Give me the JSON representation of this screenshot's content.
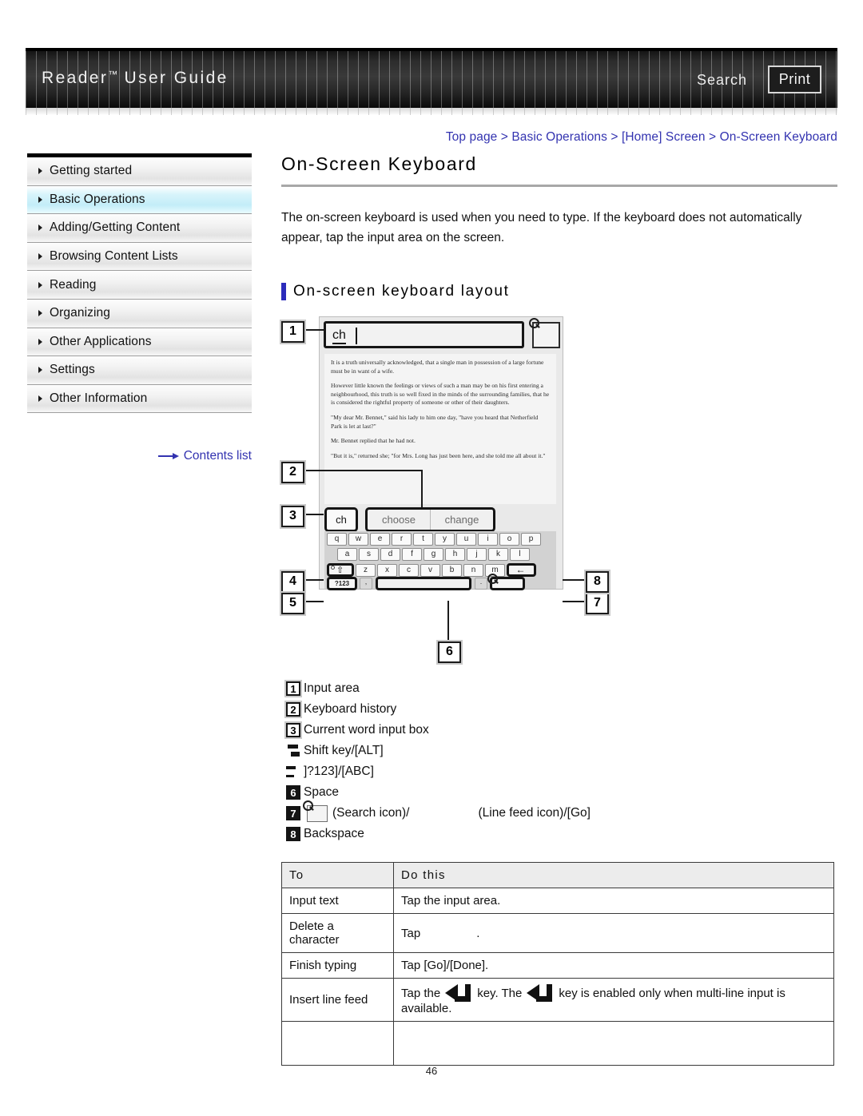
{
  "header": {
    "title_main": "Reader",
    "title_tm": "™",
    "title_rest": " User Guide",
    "search_label": "Search",
    "print_label": "Print"
  },
  "breadcrumb": {
    "text": "Top page > Basic Operations > [Home] Screen > On-Screen Keyboard"
  },
  "sidebar": {
    "items": [
      {
        "label": "Getting started",
        "active": false
      },
      {
        "label": "Basic Operations",
        "active": true
      },
      {
        "label": "Adding/Getting Content",
        "active": false
      },
      {
        "label": "Browsing Content Lists",
        "active": false
      },
      {
        "label": "Reading",
        "active": false
      },
      {
        "label": "Organizing",
        "active": false
      },
      {
        "label": "Other Applications",
        "active": false
      },
      {
        "label": "Settings",
        "active": false
      },
      {
        "label": "Other Information",
        "active": false
      }
    ],
    "contents_list_label": "Contents list"
  },
  "main": {
    "page_title": "On-Screen Keyboard",
    "intro": "The on-screen keyboard is used when you need to type. If the keyboard does not automatically appear, tap the input area on the screen.",
    "section_heading": "On-screen keyboard layout"
  },
  "figure": {
    "callouts": [
      "1",
      "2",
      "3",
      "4",
      "5",
      "6",
      "7",
      "8"
    ],
    "input_value": "ch",
    "reader_paragraphs": [
      "It is a truth universally acknowledged, that a single man in possession of a large fortune must be in want of a wife.",
      "However little known the feelings or views of such a man may be on his first entering a neighbourhood, this truth is so well fixed in the minds of the surrounding families, that he is considered the rightful property of someone or other of their daughters.",
      "\"My dear Mr. Bennet,\" said his lady to him one day, \"have you heard that Netherfield Park is let at last?\"",
      "Mr. Bennet replied that he had not.",
      "\"But it is,\" returned she; \"for Mrs. Long has just been here, and she told me all about it.\""
    ],
    "current_word": "ch",
    "suggestions": [
      "choose",
      "change"
    ],
    "row1_keys": [
      "q",
      "w",
      "e",
      "r",
      "t",
      "y",
      "u",
      "i",
      "o",
      "p"
    ],
    "row2_keys": [
      "a",
      "s",
      "d",
      "f",
      "g",
      "h",
      "j",
      "k",
      "l"
    ],
    "row3_keys": [
      "z",
      "x",
      "c",
      "v",
      "b",
      "n",
      "m"
    ],
    "shift_glyph": "⇧",
    "backspace_glyph": "←",
    "sym_key_label": "?123",
    "comma_key": ",",
    "period_key": "."
  },
  "legend": {
    "rows": [
      {
        "marker": "1",
        "style": "shadow",
        "text": "Input area"
      },
      {
        "marker": "2",
        "style": "shadow",
        "text": "Keyboard history"
      },
      {
        "marker": "3",
        "style": "shadow",
        "text": "Current word input box"
      },
      {
        "marker": "4",
        "style": "clip-a",
        "text": "Shift key/[ALT]"
      },
      {
        "marker": "5",
        "style": "clip-b",
        "text": "]?123]/[ABC]"
      },
      {
        "marker": "6",
        "style": "inverted",
        "text": "Space"
      },
      {
        "marker": "7",
        "style": "inverted",
        "text": "",
        "has_icon": true,
        "icon_name": "search-icon",
        "text_before": "(Search icon)/",
        "text_after": "(Line feed icon)/[Go]"
      },
      {
        "marker": "8",
        "style": "inverted",
        "text": "Backspace"
      }
    ]
  },
  "table": {
    "headers": [
      "To",
      "Do this"
    ],
    "rows": [
      {
        "to": "Input text",
        "do": "Tap the input area.",
        "kind": "plain"
      },
      {
        "to": "Delete a character",
        "do": "Tap",
        "do_suffix": ".",
        "kind": "blank-icon"
      },
      {
        "to": "Finish typing",
        "do": "Tap [Go]/[Done].",
        "kind": "plain"
      },
      {
        "to": "Insert line feed",
        "do_a": "Tap the",
        "do_b": "key. The",
        "do_c": "key is enabled only when multi-line input is available.",
        "kind": "linefeed"
      },
      {
        "to": "",
        "do": "",
        "kind": "empty"
      }
    ]
  },
  "footer": {
    "page_number": "46"
  }
}
